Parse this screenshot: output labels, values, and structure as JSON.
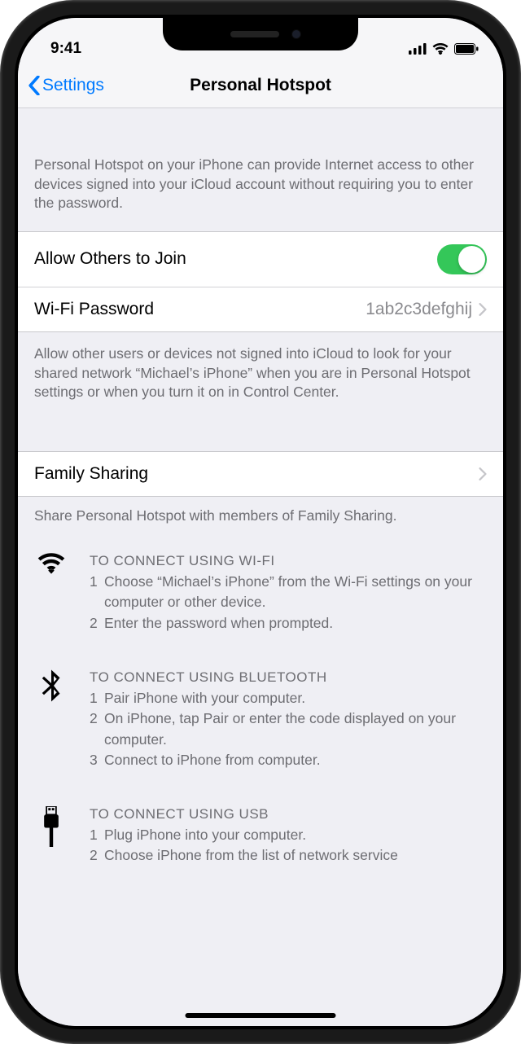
{
  "statusBar": {
    "time": "9:41"
  },
  "nav": {
    "backLabel": "Settings",
    "title": "Personal Hotspot"
  },
  "introText": "Personal Hotspot on your iPhone can provide Internet access to other devices signed into your iCloud account without requiring you to enter the password.",
  "allowOthers": {
    "label": "Allow Others to Join"
  },
  "wifiPassword": {
    "label": "Wi-Fi Password",
    "value": "1ab2c3defghij"
  },
  "allowOthersFooter": "Allow other users or devices not signed into iCloud to look for your shared network “Michael’s iPhone” when you are in Personal Hotspot settings or when you turn it on in Control Center.",
  "familySharing": {
    "label": "Family Sharing"
  },
  "familySharingFooter": "Share Personal Hotspot with members of Family Sharing.",
  "instructions": {
    "wifi": {
      "title": "TO CONNECT USING WI-FI",
      "step1_num": "1",
      "step1_text": "Choose “Michael’s iPhone” from the Wi-Fi settings on your computer or other device.",
      "step2_num": "2",
      "step2_text": "Enter the password when prompted."
    },
    "bluetooth": {
      "title": "TO CONNECT USING BLUETOOTH",
      "step1_num": "1",
      "step1_text": "Pair iPhone with your computer.",
      "step2_num": "2",
      "step2_text": "On iPhone, tap Pair or enter the code displayed on your computer.",
      "step3_num": "3",
      "step3_text": "Connect to iPhone from computer."
    },
    "usb": {
      "title": "TO CONNECT USING USB",
      "step1_num": "1",
      "step1_text": "Plug iPhone into your computer.",
      "step2_num": "2",
      "step2_text": "Choose iPhone from the list of network service"
    }
  }
}
